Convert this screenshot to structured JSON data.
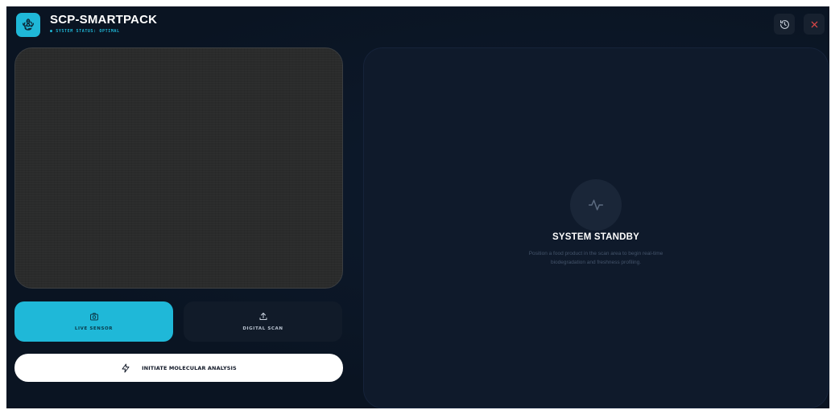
{
  "header": {
    "title": "SCP-SMARTPACK",
    "status": "● SYSTEM STATUS: OPTIMAL",
    "logo_icon": "biohazard-icon",
    "history_icon": "history-icon",
    "close_icon": "close-icon"
  },
  "capture": {
    "live_label": "LIVE SENSOR",
    "live_icon": "camera-icon",
    "scan_label": "DIGITAL SCAN",
    "scan_icon": "upload-icon",
    "analyze_label": "INITIATE MOLECULAR ANALYSIS",
    "analyze_icon": "bolt-icon"
  },
  "results": {
    "standby_icon": "pulse-icon",
    "title": "SYSTEM STANDBY",
    "description": "Position a food product in the scan area to begin real-time biodegradation and freshness profiling."
  },
  "colors": {
    "accent": "#1fb8d8",
    "background": "#0b1524",
    "panel": "#0f1a2b",
    "close": "#e04848"
  }
}
